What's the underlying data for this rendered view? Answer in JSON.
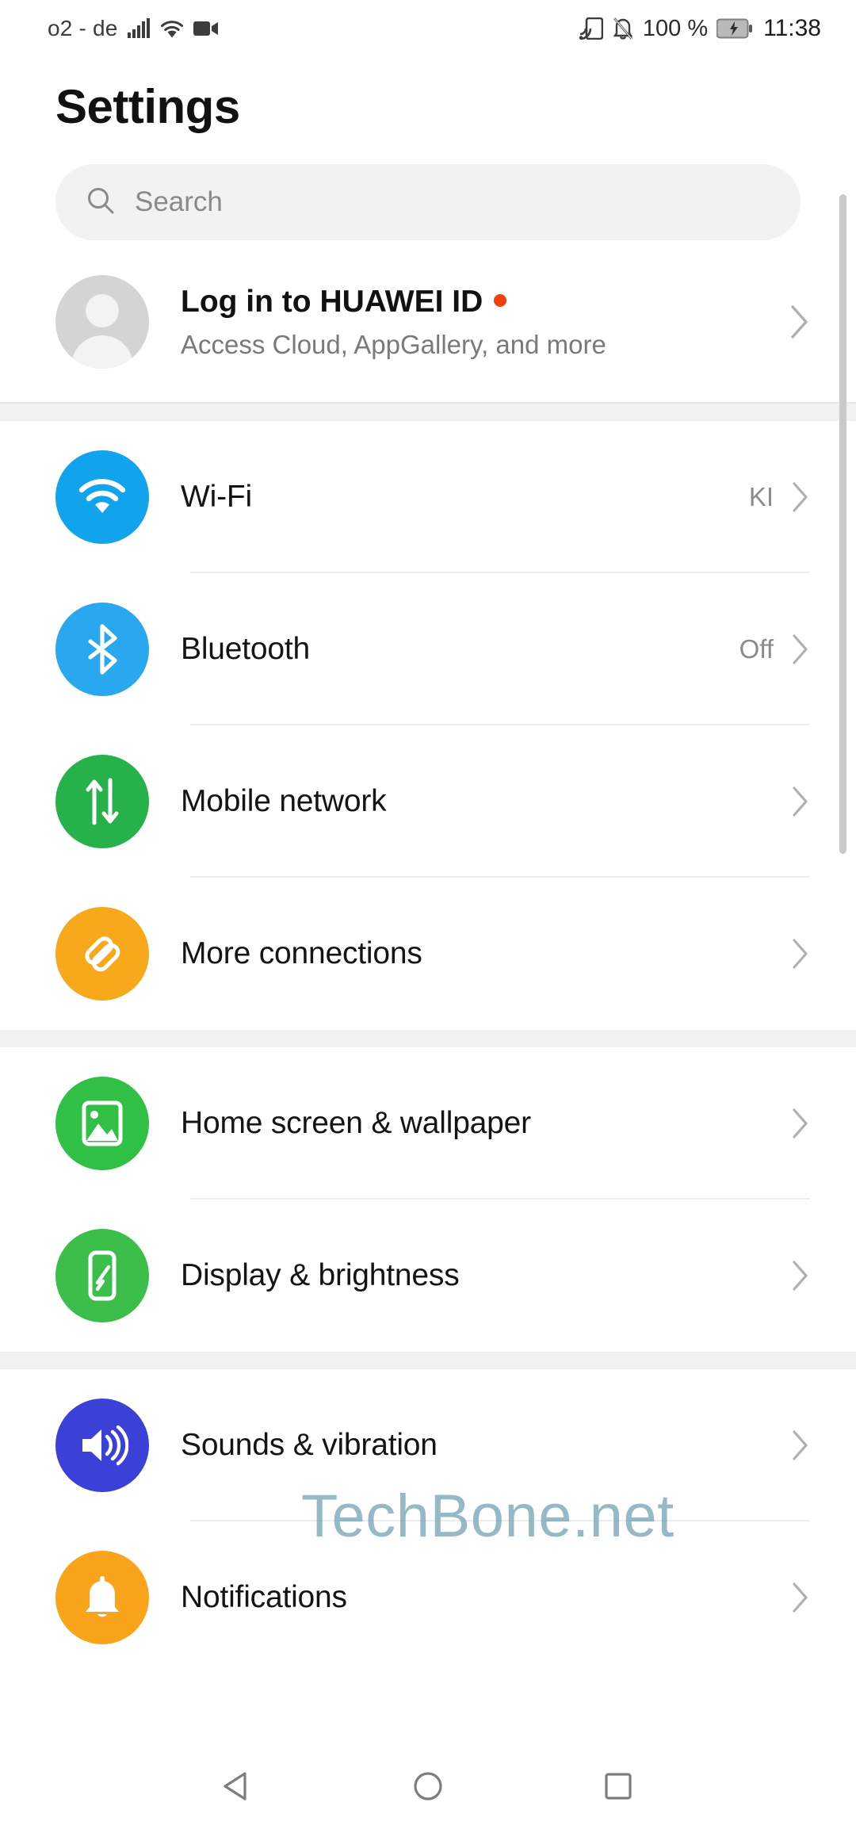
{
  "status_bar": {
    "carrier": "o2 - de",
    "signal_icon": "cellular-signal-icon",
    "wifi_icon": "wifi-icon",
    "recording_icon": "video-recording-icon",
    "cast_icon": "cast-icon",
    "mute_icon": "bell-muted-icon",
    "battery_percent": "100 %",
    "battery_icon": "battery-charging-icon",
    "clock": "11:38"
  },
  "header": {
    "title": "Settings"
  },
  "search": {
    "placeholder": "Search",
    "icon": "search-icon"
  },
  "account": {
    "title": "Log in to HUAWEI ID",
    "badge": "red-dot",
    "subtitle": "Access Cloud, AppGallery, and more",
    "avatar_icon": "user-avatar-icon",
    "chevron": "chevron-right-icon"
  },
  "sections": [
    {
      "name": "connectivity",
      "items": [
        {
          "label": "Wi-Fi",
          "value": "KI",
          "icon": "wifi-icon",
          "color": "#11a3ec"
        },
        {
          "label": "Bluetooth",
          "value": "Off",
          "icon": "bluetooth-icon",
          "color": "#29a8f0"
        },
        {
          "label": "Mobile network",
          "value": "",
          "icon": "data-transfer-icon",
          "color": "#27b14b"
        },
        {
          "label": "More connections",
          "value": "",
          "icon": "link-icon",
          "color": "#f7a81b"
        }
      ]
    },
    {
      "name": "appearance",
      "items": [
        {
          "label": "Home screen & wallpaper",
          "value": "",
          "icon": "image-icon",
          "color": "#2fc045"
        },
        {
          "label": "Display & brightness",
          "value": "",
          "icon": "brightness-phone-icon",
          "color": "#3bbf4a"
        }
      ]
    },
    {
      "name": "sound-and-notifications",
      "items": [
        {
          "label": "Sounds & vibration",
          "value": "",
          "icon": "speaker-icon",
          "color": "#3b41d6"
        },
        {
          "label": "Notifications",
          "value": "",
          "icon": "bell-icon",
          "color": "#f9a41a"
        }
      ]
    }
  ],
  "watermark": {
    "text": "TechBone.net",
    "color": "#568ea6"
  },
  "nav_bar": {
    "back": "back-triangle-icon",
    "home": "home-circle-icon",
    "recents": "recents-square-icon"
  }
}
